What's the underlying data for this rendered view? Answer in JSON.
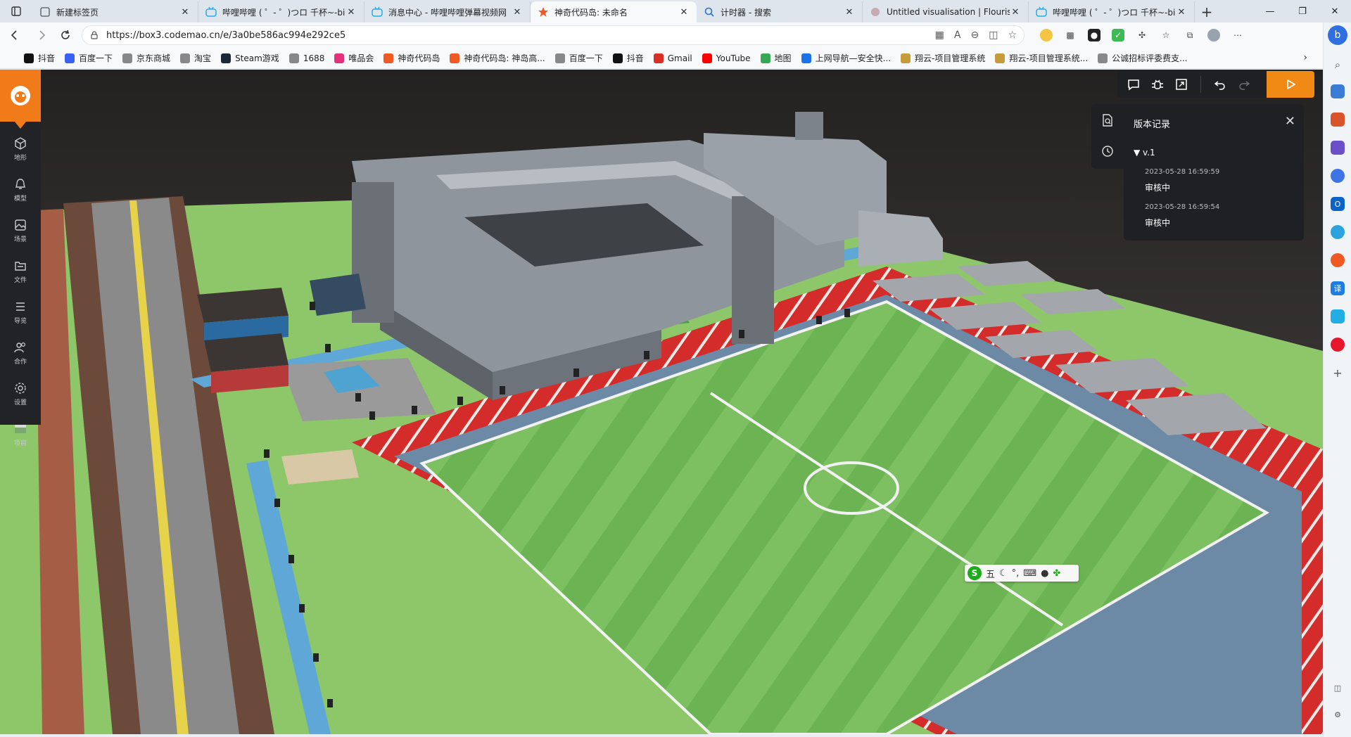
{
  "tabs": [
    {
      "title": "新建标签页",
      "icon": "page-icon",
      "active": false
    },
    {
      "title": "哔哩哔哩 ( ゜- ゜)つロ 千杯~-bili",
      "icon": "bilibili-icon",
      "active": false
    },
    {
      "title": "消息中心 - 哔哩哔哩弹幕视频网",
      "icon": "bilibili-icon",
      "active": false
    },
    {
      "title": "神奇代码岛: 未命名",
      "icon": "codemao-icon",
      "active": true
    },
    {
      "title": "计时器 - 搜索",
      "icon": "search-icon",
      "active": false
    },
    {
      "title": "Untitled visualisation | Flourish",
      "icon": "flourish-icon",
      "active": false
    },
    {
      "title": "哔哩哔哩 ( ゜- ゜)つロ 千杯~-bili",
      "icon": "bilibili-icon",
      "active": false
    }
  ],
  "address": {
    "url": "https://box3.codemao.cn/e/3a0be586ac994e292ce5"
  },
  "bookmarks": [
    {
      "label": "抖音",
      "color": "#111111"
    },
    {
      "label": "百度一下",
      "color": "#3a62f2"
    },
    {
      "label": "京东商城",
      "color": "#888888"
    },
    {
      "label": "淘宝",
      "color": "#888888"
    },
    {
      "label": "Steam游戏",
      "color": "#1b2838"
    },
    {
      "label": "1688",
      "color": "#888888"
    },
    {
      "label": "唯品会",
      "color": "#e5307b"
    },
    {
      "label": "神奇代码岛",
      "color": "#f05a22"
    },
    {
      "label": "神奇代码岛: 神岛高...",
      "color": "#f05a22"
    },
    {
      "label": "百度一下",
      "color": "#888888"
    },
    {
      "label": "抖音",
      "color": "#111111"
    },
    {
      "label": "Gmail",
      "color": "#d93025"
    },
    {
      "label": "YouTube",
      "color": "#ff0000"
    },
    {
      "label": "地图",
      "color": "#34a853"
    },
    {
      "label": "上网导航—安全快...",
      "color": "#1a73e8"
    },
    {
      "label": "翔云-项目管理系统",
      "color": "#c79a3a"
    },
    {
      "label": "翔云-项目管理系统...",
      "color": "#c79a3a"
    },
    {
      "label": "公诚招标评委费支...",
      "color": "#888888"
    }
  ],
  "editor": {
    "left_menu": [
      {
        "label": "地形",
        "icon": "cube-icon"
      },
      {
        "label": "模型",
        "icon": "bell-icon"
      },
      {
        "label": "场景",
        "icon": "image-icon"
      },
      {
        "label": "文件",
        "icon": "folder-icon"
      },
      {
        "label": "导览",
        "icon": "list-icon"
      },
      {
        "label": "合作",
        "icon": "people-icon"
      },
      {
        "label": "设置",
        "icon": "gear-icon"
      },
      {
        "label": "项目",
        "icon": "project-icon"
      }
    ],
    "version_panel": {
      "title": "版本记录",
      "version": "v.1",
      "entries": [
        {
          "time": "2023-05-28 16:59:59",
          "status": "审核中"
        },
        {
          "time": "2023-05-28 16:59:54",
          "status": "审核中"
        }
      ]
    }
  },
  "ime": {
    "mode": "五"
  },
  "colors": {
    "accent": "#f27b19",
    "play": "#f08a14",
    "panel": "#1f2023"
  }
}
